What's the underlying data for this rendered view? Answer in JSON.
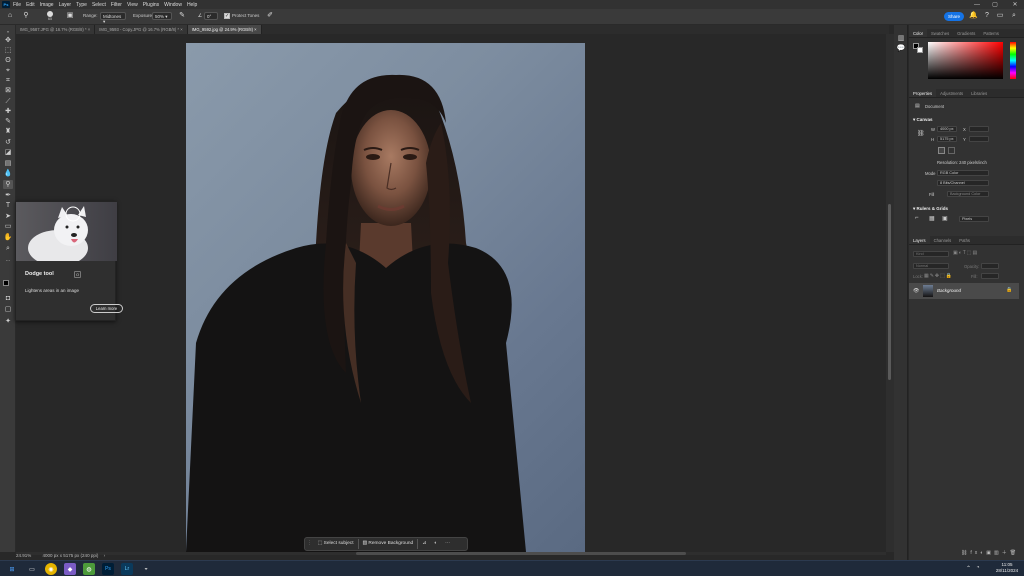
{
  "menu": {
    "logo": "Ps",
    "items": [
      "File",
      "Edit",
      "Image",
      "Layer",
      "Type",
      "Select",
      "Filter",
      "View",
      "Plugins",
      "Window",
      "Help"
    ],
    "min": "—",
    "max": "▢",
    "close": "✕"
  },
  "options": {
    "range_label": "Range:",
    "range_value": "Midtones",
    "exposure_label": "Exposure:",
    "exposure_value": "50%",
    "brush_size": "65",
    "angle_value": "0°",
    "protect_tones": "Protect Tones",
    "share": "Share"
  },
  "tabs": [
    {
      "label": "IMG_9587.JPG @ 16.7% (RGB/8) *",
      "close": "×"
    },
    {
      "label": "IMG_9593 - Copy.JPG @ 16.7% (RGB/8) *",
      "close": "×"
    },
    {
      "label": "IMG_9592.jpg @ 24.9% (RGB/8)",
      "close": "×"
    }
  ],
  "tooltip": {
    "title": "Dodge tool",
    "shortcut": "O",
    "description": "Lightens areas in an image",
    "learn_more": "Learn more"
  },
  "context_bar": {
    "select_subject": "Select subject",
    "remove_background": "Remove Background",
    "more": "···"
  },
  "status": {
    "zoom": "24.91%",
    "doc_size": "4000 px x 5175 px (240 ppi)",
    "arrow": "›"
  },
  "right_panel": {
    "color_tabs": [
      "Color",
      "Swatches",
      "Gradients",
      "Patterns"
    ],
    "prop_tabs": [
      "Properties",
      "Adjustments",
      "Libraries"
    ],
    "document_label": "Document",
    "canvas_section": "Canvas",
    "w_label": "W",
    "w_value": "4000 px",
    "h_label": "H",
    "h_value": "5175 px",
    "x_label": "X",
    "y_label": "Y",
    "resolution": "Resolution: 240 pixels/inch",
    "mode_label": "Mode",
    "mode_value": "RGB Color",
    "depth_value": "8 Bits/Channel",
    "fill_label": "Fill",
    "fill_value": "Background Color",
    "rulers_section": "Rulers & Grids",
    "units_value": "Pixels",
    "layer_tabs": [
      "Layers",
      "Channels",
      "Paths"
    ],
    "kind_value": "Kind",
    "blend_value": "Normal",
    "opacity_label": "Opacity:",
    "lock_label": "Lock:",
    "fill2_label": "Fill:",
    "layer_name": "Background"
  },
  "taskbar": {
    "time": "11:05",
    "date": "28/11/2024"
  },
  "colors": {
    "accent": "#1473e6",
    "backdrop": "#7d8da0",
    "sweater": "#141313"
  }
}
